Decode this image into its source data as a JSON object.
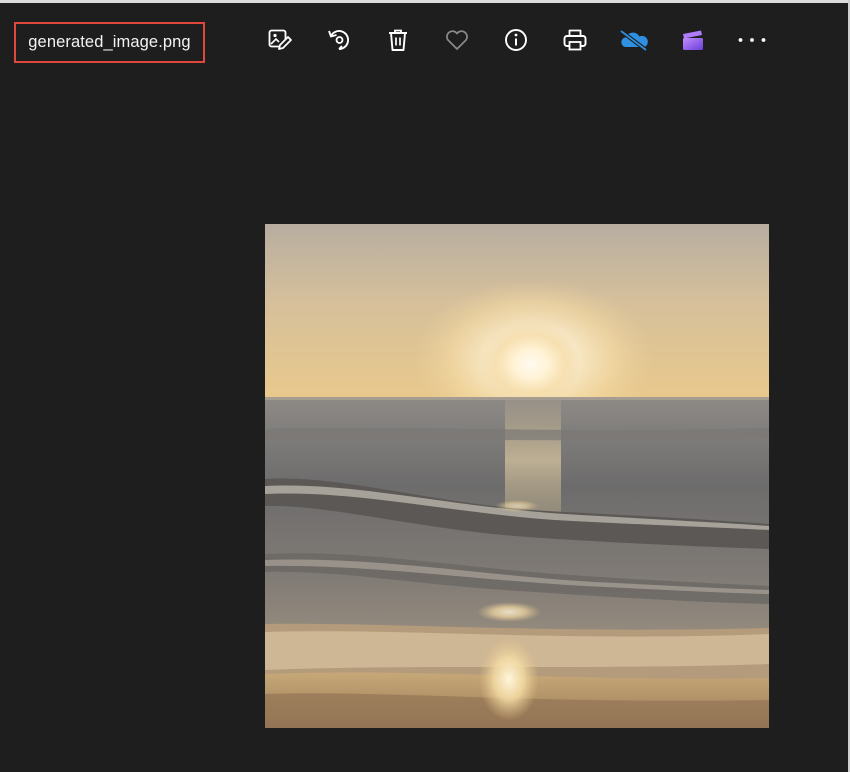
{
  "header": {
    "file_name": "generated_image.png"
  },
  "toolbar": {
    "buttons": [
      {
        "name": "edit-image-button",
        "icon": "edit-image-icon"
      },
      {
        "name": "rotate-button",
        "icon": "rotate-icon"
      },
      {
        "name": "delete-button",
        "icon": "trash-icon"
      },
      {
        "name": "favorite-button",
        "icon": "heart-icon"
      },
      {
        "name": "file-info-button",
        "icon": "info-icon"
      },
      {
        "name": "print-button",
        "icon": "printer-icon"
      },
      {
        "name": "onedrive-button",
        "icon": "onedrive-off-icon"
      },
      {
        "name": "clipchamp-button",
        "icon": "clipchamp-icon"
      },
      {
        "name": "more-options-button",
        "icon": "ellipsis-icon"
      }
    ]
  },
  "colors": {
    "background": "#1e1e1e",
    "highlight_border": "#e0483c",
    "onedrive_blue": "#2f8fe0",
    "clipchamp_purple": "#8a4fe8"
  }
}
